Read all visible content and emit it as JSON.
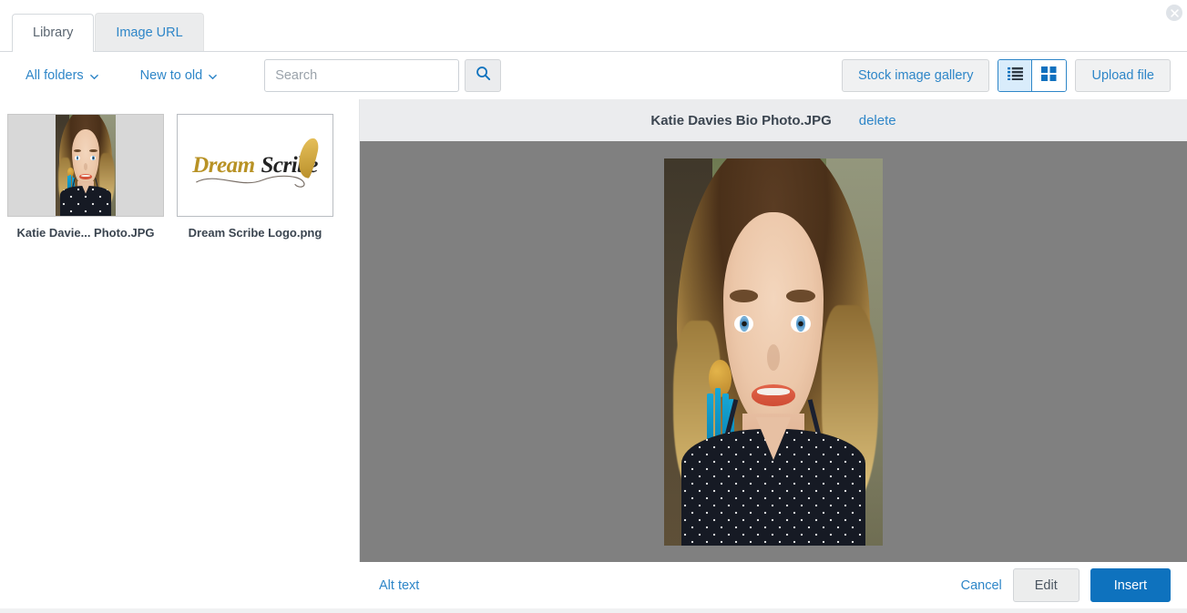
{
  "dialog": {
    "close_icon": "close-icon"
  },
  "tabs": [
    {
      "label": "Library",
      "active": true
    },
    {
      "label": "Image URL",
      "active": false
    }
  ],
  "toolbar": {
    "folder_filter": "All folders",
    "sort_filter": "New to old",
    "search_placeholder": "Search",
    "search_value": "",
    "search_icon": "search-icon",
    "stock_gallery_label": "Stock image gallery",
    "upload_label": "Upload file",
    "view_list_icon": "list-view-icon",
    "view_grid_icon": "grid-view-icon",
    "active_view": "list"
  },
  "library": {
    "items": [
      {
        "caption": "Katie Davie... Photo.JPG",
        "type": "photo",
        "selected": true
      },
      {
        "caption": "Dream Scribe Logo.png",
        "type": "logo",
        "selected": false
      }
    ]
  },
  "preview": {
    "title": "Katie Davies Bio Photo.JPG",
    "delete_label": "delete"
  },
  "footer": {
    "alt_text_label": "Alt text",
    "cancel_label": "Cancel",
    "edit_label": "Edit",
    "insert_label": "Insert"
  },
  "logo": {
    "word_one": "Dream",
    "word_two": "Scribe"
  },
  "colors": {
    "accent_blue": "#2e86c8",
    "primary_button": "#0e72be",
    "preview_backdrop": "#808080",
    "panel_gray": "#ebecee",
    "thumb_backdrop": "#d8d8d8"
  }
}
